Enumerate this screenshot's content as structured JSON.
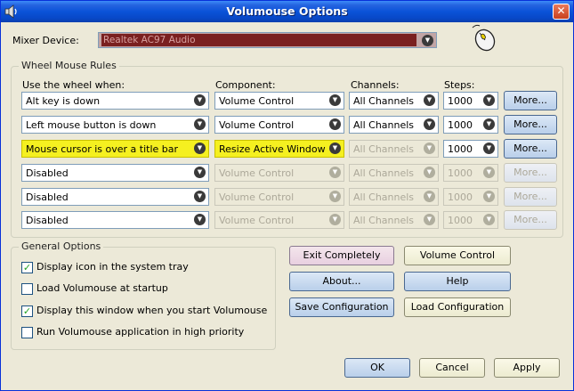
{
  "window": {
    "title": "Volumouse Options"
  },
  "mixer": {
    "label": "Mixer Device:",
    "value": "Realtek AC97 Audio"
  },
  "rules": {
    "group_title": "Wheel Mouse Rules",
    "headers": {
      "when": "Use the wheel when:",
      "component": "Component:",
      "channels": "Channels:",
      "steps": "Steps:"
    },
    "rows": [
      {
        "when": "Alt key is down",
        "component": "Volume Control",
        "channels": "All Channels",
        "steps": "1000",
        "more": "More...",
        "enabled": true,
        "highlight": false
      },
      {
        "when": "Left mouse button is down",
        "component": "Volume Control",
        "channels": "All Channels",
        "steps": "1000",
        "more": "More...",
        "enabled": true,
        "highlight": false
      },
      {
        "when": "Mouse cursor is over a title bar",
        "component": "Resize Active Window",
        "channels": "All Channels",
        "steps": "1000",
        "more": "More...",
        "enabled": true,
        "highlight": true
      },
      {
        "when": "Disabled",
        "component": "Volume Control",
        "channels": "All Channels",
        "steps": "1000",
        "more": "More...",
        "enabled": false,
        "highlight": false
      },
      {
        "when": "Disabled",
        "component": "Volume Control",
        "channels": "All Channels",
        "steps": "1000",
        "more": "More...",
        "enabled": false,
        "highlight": false
      },
      {
        "when": "Disabled",
        "component": "Volume Control",
        "channels": "All Channels",
        "steps": "1000",
        "more": "More...",
        "enabled": false,
        "highlight": false
      }
    ]
  },
  "general": {
    "group_title": "General Options",
    "options": [
      {
        "label": "Display icon in the system tray",
        "checked": true
      },
      {
        "label": "Load Volumouse at startup",
        "checked": false
      },
      {
        "label": "Display this window when you start Volumouse",
        "checked": true
      },
      {
        "label": "Run Volumouse application in high priority",
        "checked": false
      }
    ]
  },
  "buttons": {
    "exit": "Exit Completely",
    "volume": "Volume Control",
    "about": "About...",
    "help": "Help",
    "save": "Save Configuration",
    "load": "Load Configuration",
    "ok": "OK",
    "cancel": "Cancel",
    "apply": "Apply"
  },
  "colors": {
    "title_bar": "#0a53d8",
    "highlight": "#f5f020",
    "window_bg": "#ece9d8"
  }
}
